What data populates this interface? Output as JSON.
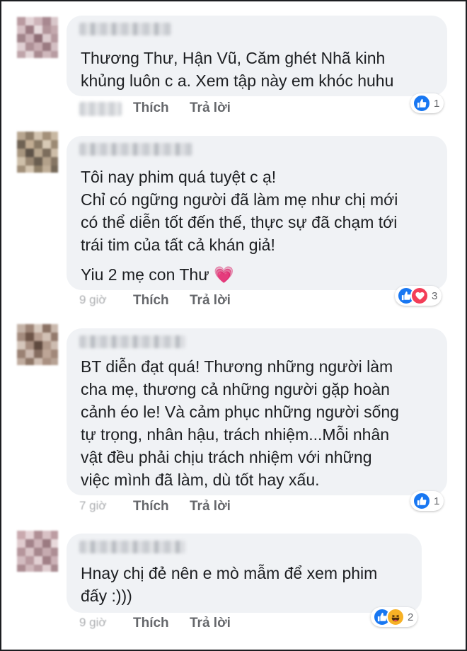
{
  "actions": {
    "like_label": "Thích",
    "reply_label": "Trả lời"
  },
  "comments": [
    {
      "lines": [
        "Thương Thư,  Hận Vũ,  Căm ghét  Nhã kinh",
        "khủng luôn c a. Xem tập này em khóc huhu"
      ],
      "time": "",
      "reactions": [
        "like"
      ],
      "reaction_count": "1"
    },
    {
      "lines": [
        "Tôi nay phim quá tuyệt c ạ!",
        "Chỉ có ngững người đã làm mẹ như chị mới",
        "có thể diễn tốt đến thế, thực sự đã chạm tới",
        "trái tim của tất cả khán giả!"
      ],
      "extra_line": "Yiu 2 mẹ con Thư",
      "extra_emoji": "💗",
      "time": "9 giờ",
      "reactions": [
        "like",
        "love"
      ],
      "reaction_count": "3"
    },
    {
      "lines": [
        "BT diễn đạt quá! Thương những người làm",
        "cha mẹ, thương cả những người gặp hoàn",
        "cảnh éo le! Và cảm phục những người sống",
        "tự trọng, nhân hậu, trách nhiệm...Mỗi nhân",
        "vật đều phải chịu trách nhiệm với những",
        "việc mình đã làm, dù tốt hay xấu."
      ],
      "time": "7 giờ",
      "reactions": [
        "like"
      ],
      "reaction_count": "1"
    },
    {
      "lines": [
        "Hnay chị đẻ nên e mò mẫm để xem phim",
        "đấy :)))"
      ],
      "time": "9 giờ",
      "reactions": [
        "like",
        "haha"
      ],
      "reaction_count": "2"
    }
  ],
  "colors": {
    "like": "#1877f2",
    "love": "#f33e58",
    "haha": "#f7b125",
    "bubble": "#f0f2f5",
    "meta": "#65676b"
  },
  "icons": {
    "like": "thumbs-up-icon",
    "love": "heart-icon",
    "haha": "laughing-face-icon"
  }
}
